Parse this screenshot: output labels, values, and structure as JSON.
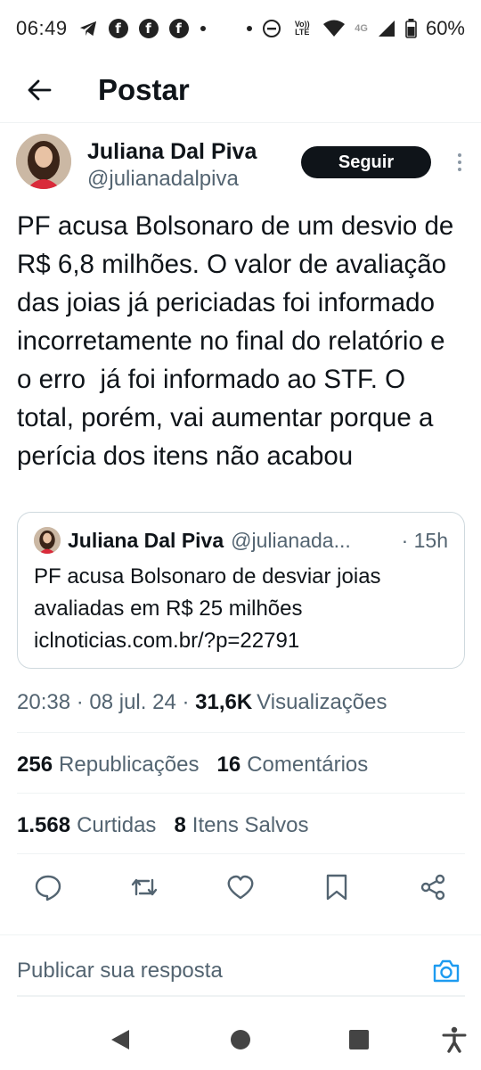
{
  "status_bar": {
    "time": "06:49",
    "net_label": "Vo)) LTE",
    "signal_label": "4G",
    "battery": "60%"
  },
  "header": {
    "title": "Postar"
  },
  "post": {
    "author_name": "Juliana Dal Piva",
    "author_handle": "@julianadalpiva",
    "follow_label": "Seguir",
    "text": "PF acusa Bolsonaro de um desvio de R$ 6,8 milhões. O valor de avaliação das joias já periciadas foi informado incorretamente no final do relatório e o erro  já foi informado ao STF. O total, porém, vai aumentar porque a perícia dos itens não acabou",
    "quote": {
      "author_name": "Juliana Dal Piva",
      "author_handle": "@julianada...",
      "time": "· 15h",
      "text": "PF acusa Bolsonaro de desviar joias avaliadas em R$ 25 milhões\niclnoticias.com.br/?p=22791"
    },
    "meta": {
      "time": "20:38",
      "sep1": " · ",
      "date": "08 jul. 24",
      "sep2": " · ",
      "views": "31,6K",
      "views_label": "Visualizações"
    },
    "stats": {
      "reposts": "256",
      "reposts_label": "Republicações",
      "comments": "16",
      "comments_label": "Comentários",
      "likes": "1.568",
      "likes_label": "Curtidas",
      "saves": "8",
      "saves_label": "Itens Salvos"
    }
  },
  "composer": {
    "placeholder": "Publicar sua resposta"
  },
  "icons": {
    "accent": "#1d9bf0",
    "text_primary": "#0f1419",
    "text_secondary": "#536471"
  }
}
